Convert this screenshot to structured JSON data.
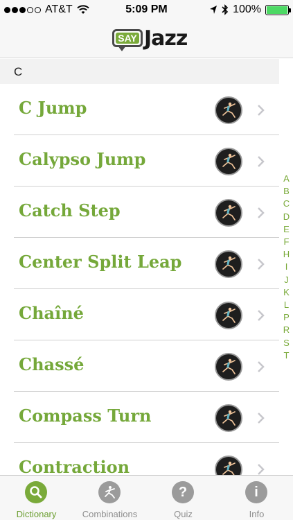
{
  "status_bar": {
    "carrier": "AT&T",
    "time": "5:09 PM",
    "battery": "100%",
    "signal_dots_filled": 3,
    "signal_dots_total": 5,
    "battery_level": 1.0,
    "battery_color": "#4cd964"
  },
  "header": {
    "logo_say": "SAY",
    "logo_jazz": "Jazz"
  },
  "section": {
    "letter": "C"
  },
  "list": {
    "items": [
      {
        "label": "C Jump",
        "thumb_icon": "dancer-icon",
        "chevron_icon": "chevron-right-icon"
      },
      {
        "label": "Calypso Jump",
        "thumb_icon": "dancer-icon",
        "chevron_icon": "chevron-right-icon"
      },
      {
        "label": "Catch Step",
        "thumb_icon": "dancer-icon",
        "chevron_icon": "chevron-right-icon"
      },
      {
        "label": "Center Split Leap",
        "thumb_icon": "dancer-icon",
        "chevron_icon": "chevron-right-icon"
      },
      {
        "label": "Chaîné",
        "thumb_icon": "dancer-icon",
        "chevron_icon": "chevron-right-icon"
      },
      {
        "label": "Chassé",
        "thumb_icon": "dancer-icon",
        "chevron_icon": "chevron-right-icon"
      },
      {
        "label": "Compass Turn",
        "thumb_icon": "dancer-icon",
        "chevron_icon": "chevron-right-icon"
      },
      {
        "label": "Contraction",
        "thumb_icon": "dancer-icon",
        "chevron_icon": "chevron-right-icon"
      }
    ]
  },
  "index": [
    "A",
    "B",
    "C",
    "D",
    "E",
    "F",
    "H",
    "I",
    "J",
    "K",
    "L",
    "P",
    "R",
    "S",
    "T"
  ],
  "tab_bar": {
    "tabs": [
      {
        "label": "Dictionary",
        "icon": "search-icon",
        "active": true
      },
      {
        "label": "Combinations",
        "icon": "dancer-icon",
        "active": false
      },
      {
        "label": "Quiz",
        "icon": "question-icon",
        "active": false
      },
      {
        "label": "Info",
        "icon": "info-icon",
        "active": false
      }
    ]
  },
  "colors": {
    "accent_green": "#75a83a",
    "tab_active": "#7aaa3a",
    "tab_inactive": "#9b9b9b"
  }
}
